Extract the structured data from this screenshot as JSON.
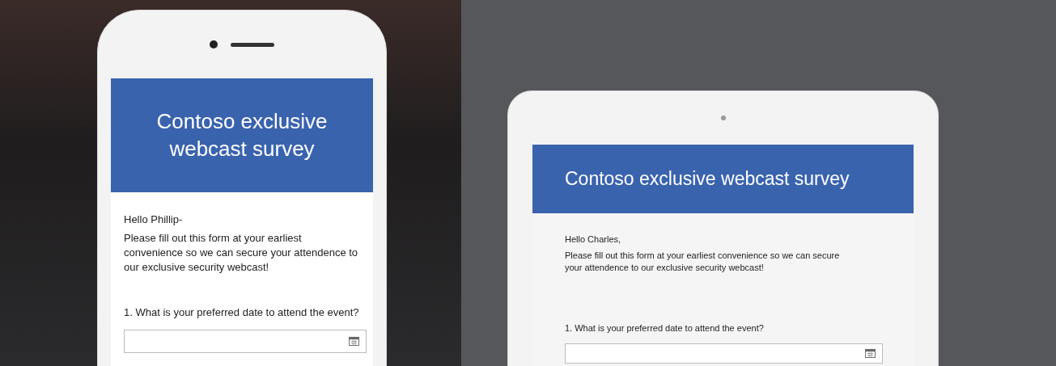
{
  "devices": [
    {
      "kind": "phone",
      "title": "Contoso exclusive webcast survey",
      "greeting": "Hello Phillip-",
      "message": "Please fill out this form at your earliest convenience so we can secure your attendence to our exclusive security webcast!",
      "question": "1. What is your preferred date to attend the event?"
    },
    {
      "kind": "tablet",
      "title": "Contoso exclusive webcast survey",
      "greeting": "Hello Charles,",
      "message": "Please fill out this form at your earliest convenience so we can secure your attendence to our exclusive security webcast!",
      "question": "1. What is your preferred date to attend the event?"
    }
  ]
}
